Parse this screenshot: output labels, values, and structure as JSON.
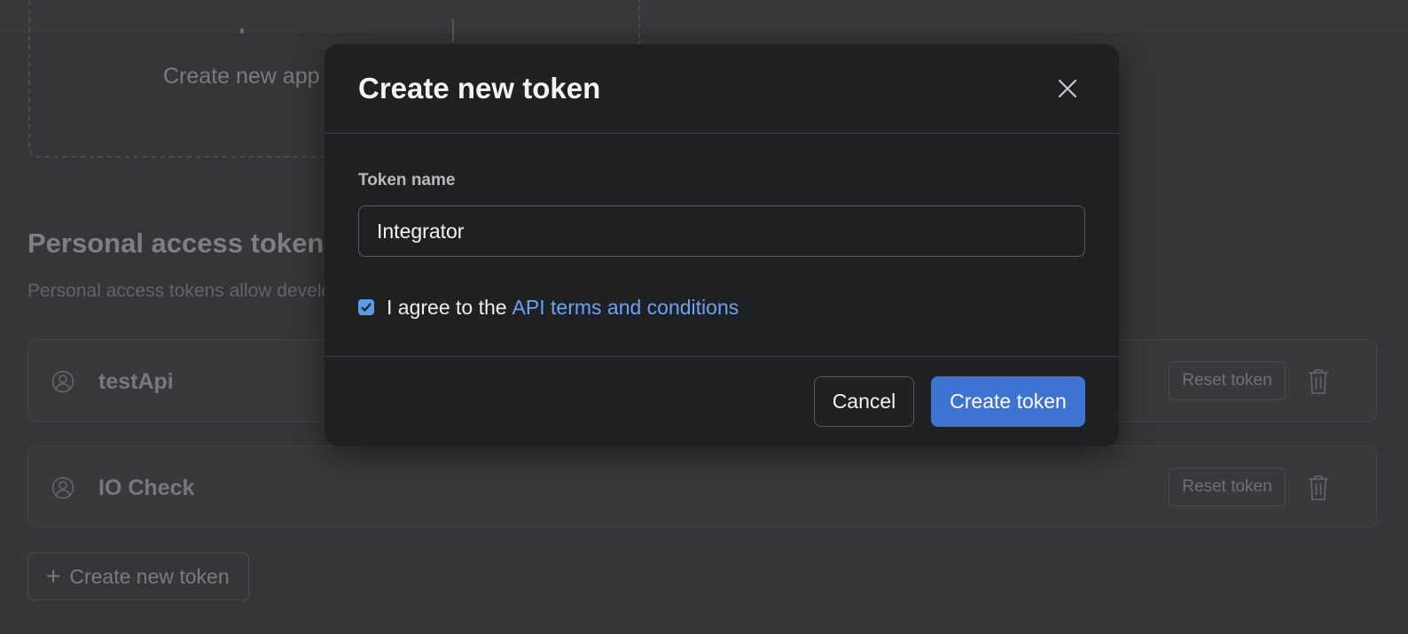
{
  "background": {
    "app_card_text": "Create new app",
    "section": {
      "title": "Personal access tokens",
      "description": "Personal access tokens allow developers"
    },
    "tokens": [
      {
        "name": "testApi",
        "reset_label": "Reset token"
      },
      {
        "name": "IO Check",
        "reset_label": "Reset token"
      }
    ],
    "create_button_label": "Create new token"
  },
  "modal": {
    "title": "Create new token",
    "field_label": "Token name",
    "input_value": "Integrator",
    "checkbox_checked": true,
    "agree_text": "I agree to the",
    "agree_link": "API terms and conditions",
    "cancel_label": "Cancel",
    "submit_label": "Create token"
  },
  "colors": {
    "page_background": "#353638",
    "modal_background": "#1f2022",
    "primary": "#3f73d3",
    "link": "#6aa3f5",
    "checkbox": "#5b9bea"
  },
  "icons": {
    "close": "close-icon",
    "checkbox": "check-icon",
    "token_avatar": "user-circle-icon",
    "delete": "trash-icon",
    "add": "plus-icon"
  }
}
